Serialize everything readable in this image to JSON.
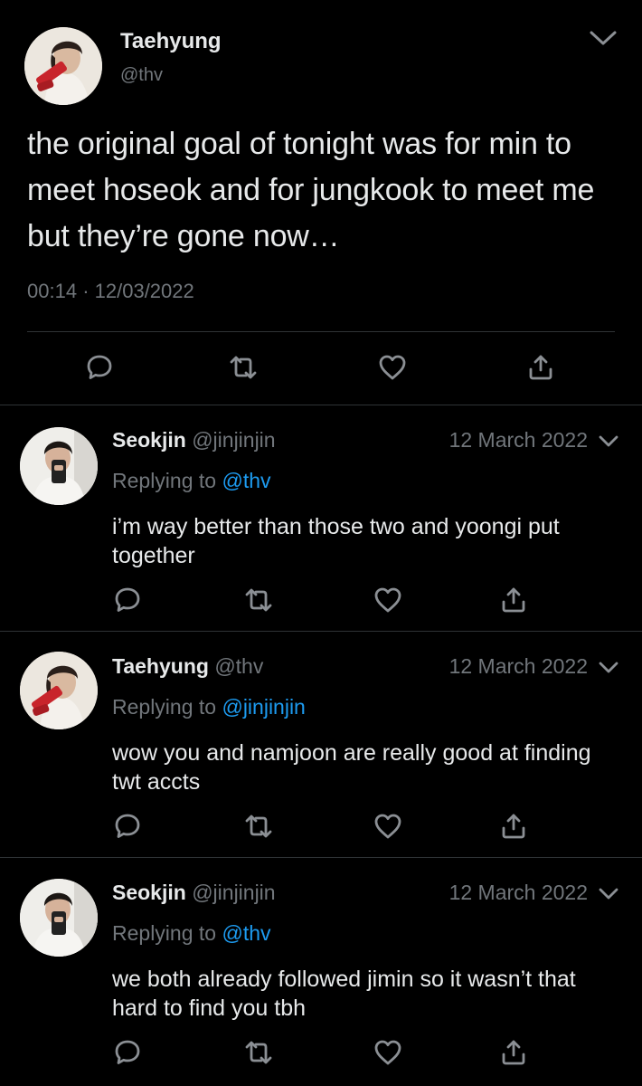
{
  "main_tweet": {
    "name": "Taehyung",
    "handle": "@thv",
    "text": "the original goal of tonight was for min to meet hoseok and for jungkook to meet me but they’re gone now…",
    "time": "00:14",
    "separator": "·",
    "date": "12/03/2022"
  },
  "replies": [
    {
      "name": "Seokjin",
      "handle": "@jinjinjin",
      "date": "12 March 2022",
      "replying_prefix": "Replying to",
      "replying_to": "@thv",
      "text": "i’m way better than those two and yoongi put together"
    },
    {
      "name": "Taehyung",
      "handle": "@thv",
      "date": "12 March 2022",
      "replying_prefix": "Replying to",
      "replying_to": "@jinjinjin",
      "text": "wow you and namjoon are really good at finding twt accts"
    },
    {
      "name": "Seokjin",
      "handle": "@jinjinjin",
      "date": "12 March 2022",
      "replying_prefix": "Replying to",
      "replying_to": "@thv",
      "text": "we both already followed jimin so it wasn’t that hard to find you tbh"
    }
  ],
  "icons": {
    "reply": "reply-icon",
    "retweet": "retweet-icon",
    "like": "heart-icon",
    "share": "share-icon",
    "more": "chevron-down-icon"
  },
  "colors": {
    "background": "#000000",
    "text": "#e7e9ea",
    "secondary": "#71767b",
    "link": "#1d9bf0",
    "divider": "#2f3336"
  }
}
